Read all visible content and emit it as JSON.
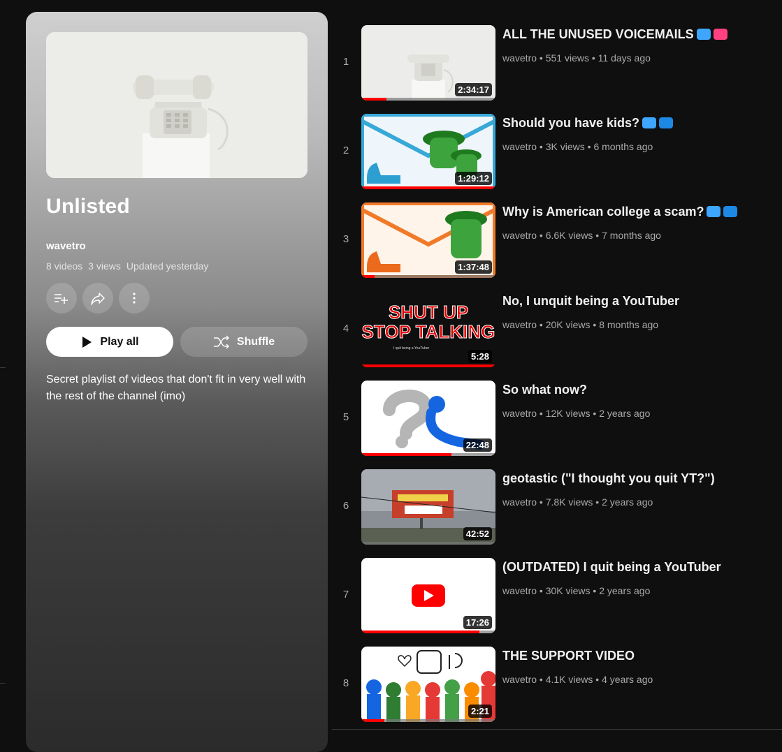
{
  "playlist": {
    "title": "Unlisted",
    "owner": "wavetro",
    "video_count": "8 videos",
    "view_count": "3 views",
    "updated": "Updated yesterday",
    "play_all_label": "Play all",
    "shuffle_label": "Shuffle",
    "description": "Secret playlist of videos that don't fit in very well with the rest of the channel (imo)",
    "action_icons": [
      "add-to-queue-icon",
      "share-icon",
      "more-vert-icon"
    ]
  },
  "videos": [
    {
      "index": "1",
      "title": "ALL THE UNUSED VOICEMAILS",
      "emojis": [
        "#3ea6ff",
        "#ff4081"
      ],
      "channel": "wavetro",
      "views": "551 views",
      "age": "11 days ago",
      "duration": "2:34:17",
      "progress": 0.19
    },
    {
      "index": "2",
      "title": "Should you have kids?",
      "emojis": [
        "#3ea6ff",
        "#e53935"
      ],
      "channel": "wavetro",
      "views": "3K views",
      "age": "6 months ago",
      "duration": "1:29:12",
      "progress": 1.0
    },
    {
      "index": "3",
      "title": "Why is American college a scam?",
      "emojis": [
        "#3ea6ff",
        "#e53935"
      ],
      "channel": "wavetro",
      "views": "6.6K views",
      "age": "7 months ago",
      "duration": "1:37:48",
      "progress": 0.1
    },
    {
      "index": "4",
      "title": "No, I unquit being a YouTuber",
      "emojis": [],
      "channel": "wavetro",
      "views": "20K views",
      "age": "8 months ago",
      "duration": "5:28",
      "progress": 1.0
    },
    {
      "index": "5",
      "title": "So what now?",
      "emojis": [],
      "channel": "wavetro",
      "views": "12K views",
      "age": "2 years ago",
      "duration": "22:48",
      "progress": 0.67
    },
    {
      "index": "6",
      "title": "geotastic (\"I thought you quit YT?\")",
      "emojis": [],
      "channel": "wavetro",
      "views": "7.8K views",
      "age": "2 years ago",
      "duration": "42:52",
      "progress": 0.0
    },
    {
      "index": "7",
      "title": "(OUTDATED) I quit being a YouTuber",
      "emojis": [],
      "channel": "wavetro",
      "views": "30K views",
      "age": "2 years ago",
      "duration": "17:26",
      "progress": 0.88
    },
    {
      "index": "8",
      "title": "THE SUPPORT VIDEO",
      "emojis": [],
      "channel": "wavetro",
      "views": "4.1K views",
      "age": "4 years ago",
      "duration": "2:21",
      "progress": 0.17
    }
  ],
  "thumb4_text": {
    "line1": "SHUT UP",
    "line2": "STOP TALKING",
    "caption": "I quit being a YouTuber"
  }
}
